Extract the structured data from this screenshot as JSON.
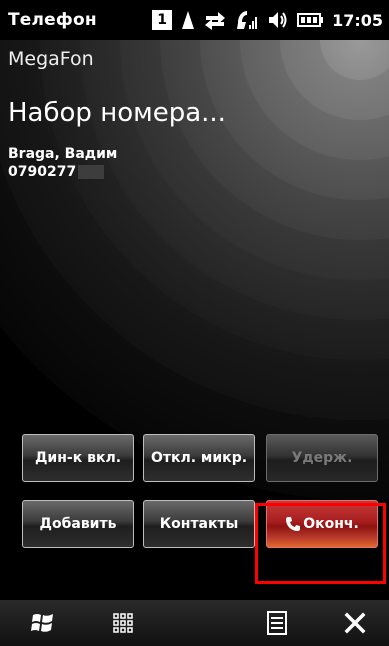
{
  "status_bar": {
    "title": "Телефон",
    "sim_slot": "1",
    "time": "17:05",
    "icons": [
      "sim-1-icon",
      "signal-arrow-icon",
      "data-transfer-icon",
      "signal-strength-icon",
      "speaker-icon",
      "battery-icon"
    ]
  },
  "call": {
    "operator": "MegaFon",
    "status": "Набор номера...",
    "contact_name": "Braga, Вадим",
    "contact_number": "0790277"
  },
  "buttons": {
    "speaker": "Дин-к вкл.",
    "mute": "Откл. микр.",
    "hold": "Удерж.",
    "add": "Добавить",
    "contacts": "Контакты",
    "end": "Оконч."
  },
  "colors": {
    "end_call": "#a81e1e",
    "highlight": "#ff0000"
  },
  "bottom_bar": {
    "icons": [
      "windows-start-icon",
      "apps-grid-icon",
      "menu-list-icon",
      "close-icon"
    ]
  }
}
